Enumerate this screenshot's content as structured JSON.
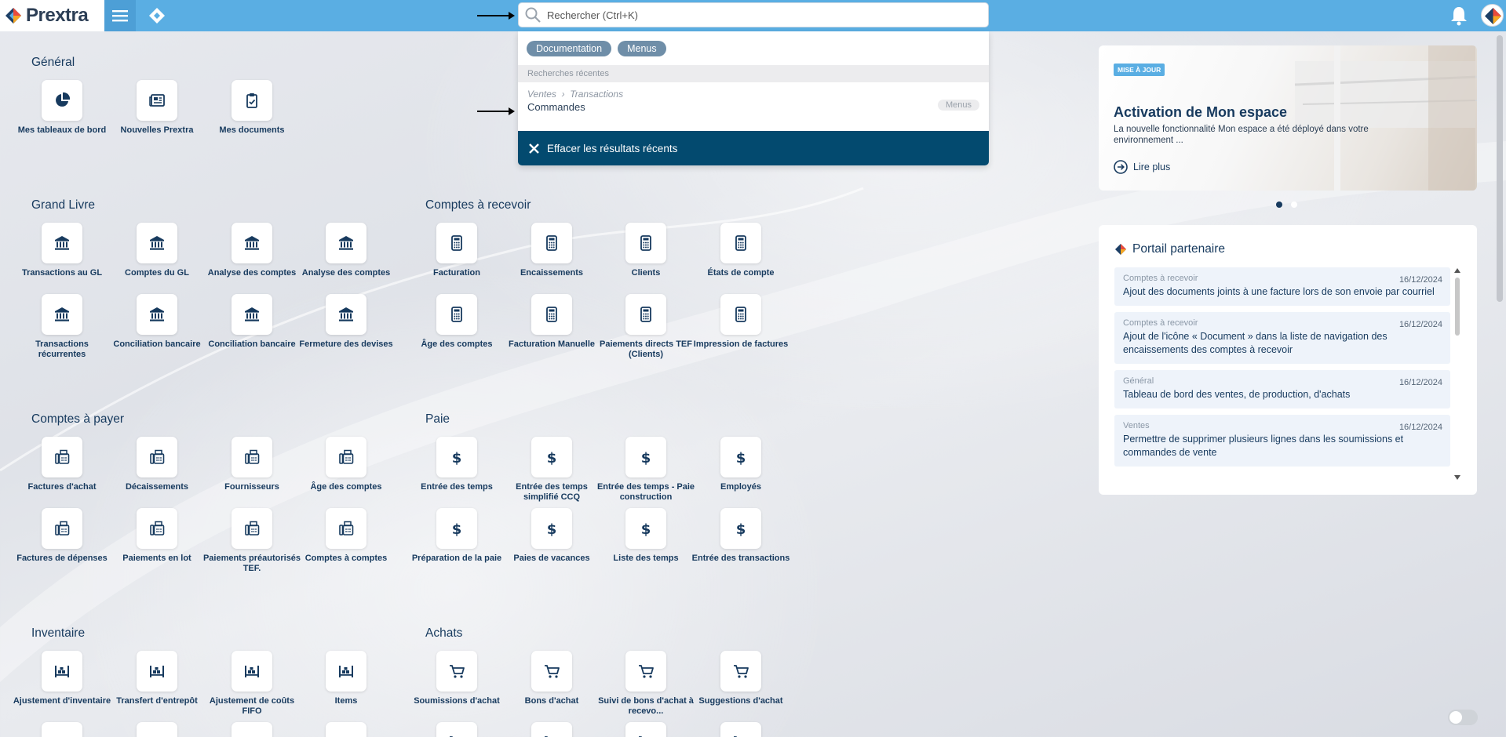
{
  "app": {
    "logo_text": "Prextra",
    "brand_color": "#5aaee3",
    "accent_dark": "#034a6f",
    "text_color": "#173a5e"
  },
  "search": {
    "placeholder": "Rechercher (Ctrl+K)",
    "chips": [
      "Documentation",
      "Menus"
    ],
    "recent_header": "Recherches récentes",
    "recent": [
      {
        "path_1": "Ventes",
        "path_2": "Transactions",
        "name": "Commandes",
        "tag": "Menus"
      }
    ],
    "clear_label": "Effacer les résultats récents"
  },
  "sections": {
    "general": {
      "title": "Général",
      "tiles": [
        {
          "label": "Mes tableaux de bord",
          "icon": "pie-chart-icon"
        },
        {
          "label": "Nouvelles Prextra",
          "icon": "newspaper-icon"
        },
        {
          "label": "Mes documents",
          "icon": "clipboard-check-icon"
        }
      ]
    },
    "grand_livre": {
      "title": "Grand Livre",
      "tiles": [
        {
          "label": "Transactions au GL",
          "icon": "bank-icon"
        },
        {
          "label": "Comptes du GL",
          "icon": "bank-icon"
        },
        {
          "label": "Analyse des comptes",
          "icon": "bank-icon"
        },
        {
          "label": "Analyse des comptes",
          "icon": "bank-icon"
        },
        {
          "label": "Transactions récurrentes",
          "icon": "bank-icon"
        },
        {
          "label": "Conciliation bancaire",
          "icon": "bank-icon"
        },
        {
          "label": "Conciliation bancaire",
          "icon": "bank-icon"
        },
        {
          "label": "Fermeture des devises",
          "icon": "bank-icon"
        }
      ]
    },
    "comptes_recevoir": {
      "title": "Comptes à recevoir",
      "tiles": [
        {
          "label": "Facturation",
          "icon": "calculator-icon"
        },
        {
          "label": "Encaissements",
          "icon": "calculator-icon"
        },
        {
          "label": "Clients",
          "icon": "calculator-icon"
        },
        {
          "label": "États de compte",
          "icon": "calculator-icon"
        },
        {
          "label": "Âge des comptes",
          "icon": "calculator-icon"
        },
        {
          "label": "Facturation Manuelle",
          "icon": "calculator-icon"
        },
        {
          "label": "Paiements directs TEF (Clients)",
          "icon": "calculator-icon"
        },
        {
          "label": "Impression de factures",
          "icon": "calculator-icon"
        }
      ]
    },
    "comptes_payer": {
      "title": "Comptes à payer",
      "tiles": [
        {
          "label": "Factures d'achat",
          "icon": "fax-icon"
        },
        {
          "label": "Décaissements",
          "icon": "fax-icon"
        },
        {
          "label": "Fournisseurs",
          "icon": "fax-icon"
        },
        {
          "label": "Âge des comptes",
          "icon": "fax-icon"
        },
        {
          "label": "Factures de dépenses",
          "icon": "fax-icon"
        },
        {
          "label": "Paiements en lot",
          "icon": "fax-icon"
        },
        {
          "label": "Paiements préautorisés TEF.",
          "icon": "fax-icon"
        },
        {
          "label": "Comptes à comptes",
          "icon": "fax-icon"
        }
      ]
    },
    "paie": {
      "title": "Paie",
      "tiles": [
        {
          "label": "Entrée des temps",
          "icon": "dollar-icon"
        },
        {
          "label": "Entrée des temps simplifié CCQ",
          "icon": "dollar-icon"
        },
        {
          "label": "Entrée des temps - Paie construction",
          "icon": "dollar-icon"
        },
        {
          "label": "Employés",
          "icon": "dollar-icon"
        },
        {
          "label": "Préparation de la paie",
          "icon": "dollar-icon"
        },
        {
          "label": "Paies de vacances",
          "icon": "dollar-icon"
        },
        {
          "label": "Liste des temps",
          "icon": "dollar-icon"
        },
        {
          "label": "Entrée des transactions",
          "icon": "dollar-icon"
        }
      ]
    },
    "inventaire": {
      "title": "Inventaire",
      "tiles": [
        {
          "label": "Ajustement d'inventaire",
          "icon": "warehouse-icon"
        },
        {
          "label": "Transfert d'entrepôt",
          "icon": "warehouse-icon"
        },
        {
          "label": "Ajustement de coûts FIFO",
          "icon": "warehouse-icon"
        },
        {
          "label": "Items",
          "icon": "warehouse-icon"
        }
      ]
    },
    "achats": {
      "title": "Achats",
      "tiles": [
        {
          "label": "Soumissions d'achat",
          "icon": "cart-icon"
        },
        {
          "label": "Bons d'achat",
          "icon": "cart-icon"
        },
        {
          "label": "Suivi de bons d'achat à recevo...",
          "icon": "cart-icon"
        },
        {
          "label": "Suggestions d'achat",
          "icon": "cart-icon"
        }
      ]
    }
  },
  "news": {
    "badge": "MISE À JOUR",
    "title": "Activation de Mon espace",
    "description": "La nouvelle fonctionnalité Mon espace a été déployé dans votre environnement ...",
    "link": "Lire plus",
    "slide_count": 2,
    "active_slide": 1
  },
  "portal": {
    "title": "Portail partenaire",
    "items": [
      {
        "category": "Comptes à recevoir",
        "date": "16/12/2024",
        "text": "Ajout des documents joints à une facture lors de son envoie par courriel"
      },
      {
        "category": "Comptes à recevoir",
        "date": "16/12/2024",
        "text": "Ajout de l'icône « Document » dans la liste de navigation des encaissements des comptes à recevoir"
      },
      {
        "category": "Général",
        "date": "16/12/2024",
        "text": "Tableau de bord des ventes, de production, d'achats"
      },
      {
        "category": "Ventes",
        "date": "16/12/2024",
        "text": "Permettre de supprimer plusieurs lignes dans les soumissions et commandes de vente"
      }
    ]
  }
}
